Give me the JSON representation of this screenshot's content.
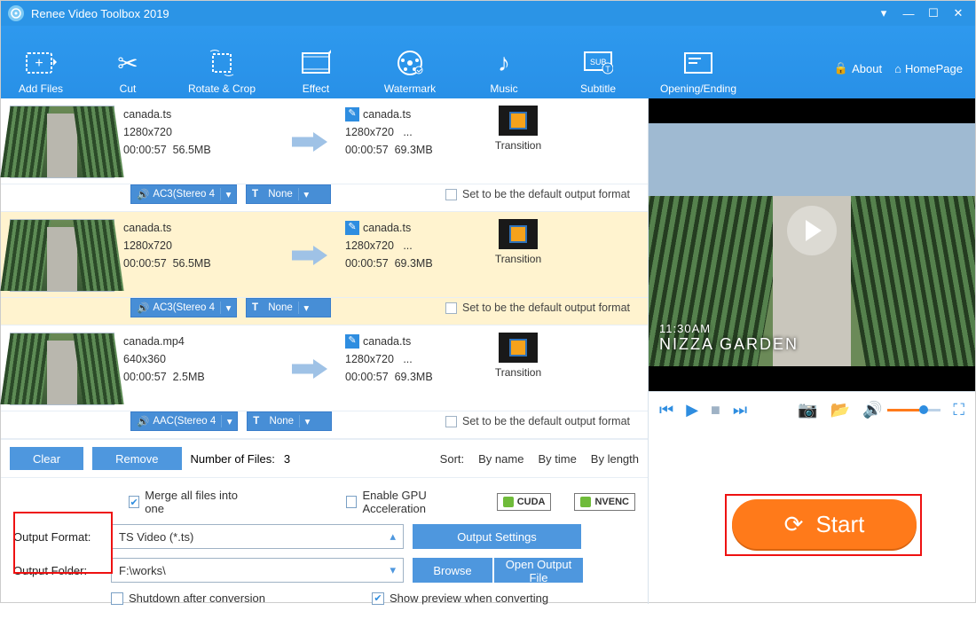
{
  "app": {
    "title": "Renee Video Toolbox 2019"
  },
  "toolbar": {
    "items": [
      {
        "label": "Add Files"
      },
      {
        "label": "Cut"
      },
      {
        "label": "Rotate & Crop"
      },
      {
        "label": "Effect"
      },
      {
        "label": "Watermark"
      },
      {
        "label": "Music"
      },
      {
        "label": "Subtitle"
      },
      {
        "label": "Opening/Ending"
      }
    ],
    "about": "About",
    "homepage": "HomePage"
  },
  "files": [
    {
      "in_name": "canada.ts",
      "in_res": "1280x720",
      "in_dur": "00:00:57",
      "in_size": "56.5MB",
      "out_name": "canada.ts",
      "out_res": "1280x720",
      "out_extra": "...",
      "out_dur": "00:00:57",
      "out_size": "69.3MB",
      "audio": "AC3(Stereo 4",
      "sub": "None",
      "trans": "Transition",
      "selected": false
    },
    {
      "in_name": "canada.ts",
      "in_res": "1280x720",
      "in_dur": "00:00:57",
      "in_size": "56.5MB",
      "out_name": "canada.ts",
      "out_res": "1280x720",
      "out_extra": "...",
      "out_dur": "00:00:57",
      "out_size": "69.3MB",
      "audio": "AC3(Stereo 4",
      "sub": "None",
      "trans": "Transition",
      "selected": true
    },
    {
      "in_name": "canada.mp4",
      "in_res": "640x360",
      "in_dur": "00:00:57",
      "in_size": "2.5MB",
      "out_name": "canada.ts",
      "out_res": "1280x720",
      "out_extra": "...",
      "out_dur": "00:00:57",
      "out_size": "69.3MB",
      "audio": "AAC(Stereo 4",
      "sub": "None",
      "trans": "Transition",
      "selected": false
    }
  ],
  "list_footer": {
    "clear": "Clear",
    "remove": "Remove",
    "count_label": "Number of Files:",
    "count": "3",
    "sort_label": "Sort:",
    "sort_name": "By name",
    "sort_time": "By time",
    "sort_length": "By length"
  },
  "row_labels": {
    "sub_prefix": "T",
    "default_out": "Set to be the default output format"
  },
  "options": {
    "merge": "Merge all files into one",
    "gpu": "Enable GPU Acceleration",
    "cuda": "CUDA",
    "nvenc": "NVENC",
    "format_label": "Output Format:",
    "folder_label": "Output Folder:",
    "format_value": "TS Video (*.ts)",
    "folder_value": "F:\\works\\",
    "output_settings": "Output Settings",
    "browse": "Browse",
    "open_output": "Open Output File",
    "shutdown": "Shutdown after conversion",
    "preview": "Show preview when converting"
  },
  "preview": {
    "time": "11:30AM",
    "place": "NIZZA GARDEN"
  },
  "start": {
    "label": "Start"
  }
}
